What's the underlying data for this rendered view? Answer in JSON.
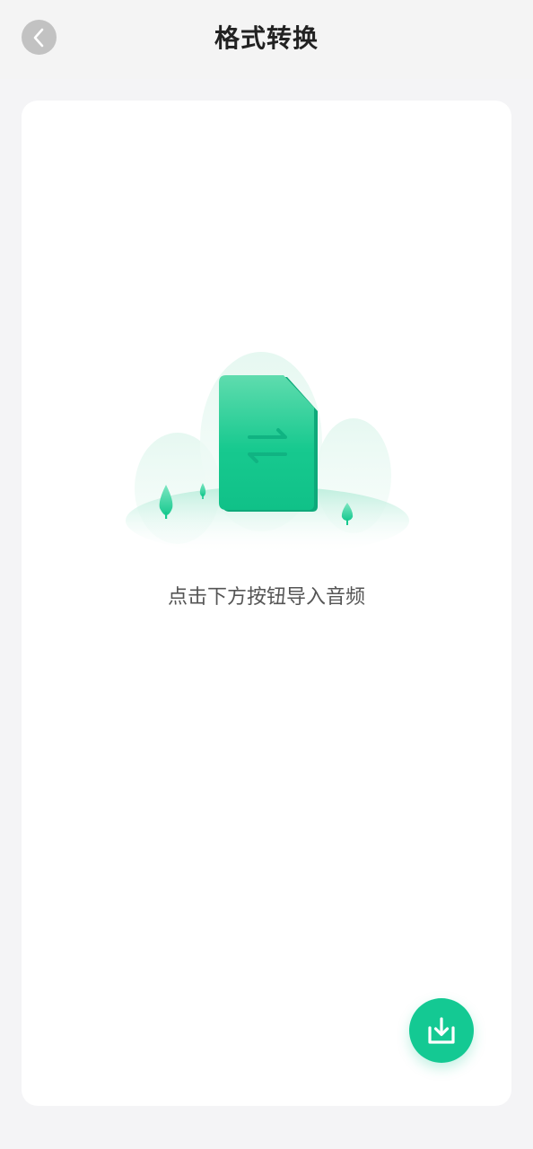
{
  "header": {
    "title": "格式转换",
    "back_icon": "chevron-left-icon"
  },
  "empty_state": {
    "illustration": "file-convert-illustration",
    "hint": "点击下方按钮导入音频"
  },
  "fab": {
    "icon": "import-download-icon"
  },
  "colors": {
    "accent": "#14C993",
    "background": "#F4F4F6",
    "card": "#FFFFFF",
    "text_primary": "#222222",
    "text_secondary": "#555555"
  }
}
